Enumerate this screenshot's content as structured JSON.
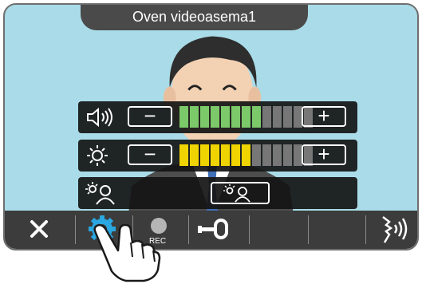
{
  "title": "Oven videoasema1",
  "volume": {
    "level": 8,
    "max": 13,
    "active_color": "#7cc96a",
    "inactive_color": "#777777"
  },
  "brightness": {
    "level": 7,
    "max": 13,
    "active_color": "#f0d400",
    "inactive_color": "#777777"
  },
  "toolbar": {
    "rec_label": "REC",
    "active_color": "#2aa7e0"
  },
  "icons": {
    "close": "close-icon",
    "settings": "gear-icon",
    "rec": "record-icon",
    "unlock": "key-icon",
    "talk": "talk-icon",
    "volume": "speaker-icon",
    "brightness": "sun-icon",
    "backlight": "backlight-icon"
  }
}
